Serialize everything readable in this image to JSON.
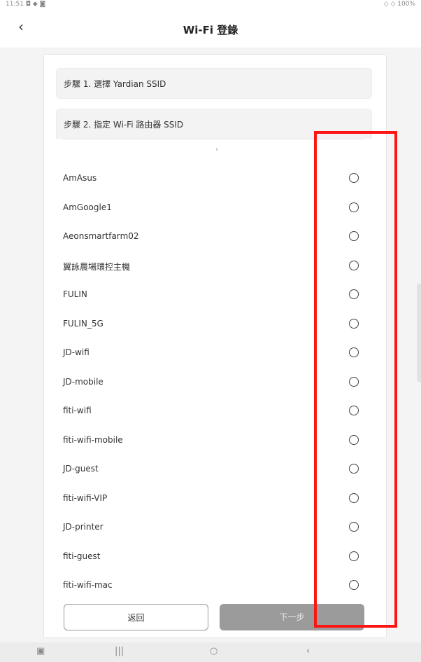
{
  "status_bar": {
    "left": "11:51 ◘ ◆ ◙",
    "right": "◇ ◇ 100%"
  },
  "header": {
    "back_icon": "chevron-left-icon",
    "title": "Wi-Fi 登錄"
  },
  "steps": {
    "step1_label": "步驟 1. 選擇 Yardian SSID",
    "step2_label": "步驟 2. 指定 Wi-Fi 路由器 SSID"
  },
  "networks": [
    {
      "ssid": "AmAsus"
    },
    {
      "ssid": "AmGoogle1"
    },
    {
      "ssid": "Aeonsmartfarm02"
    },
    {
      "ssid": "翼詠農場環控主機"
    },
    {
      "ssid": "FULIN"
    },
    {
      "ssid": "FULIN_5G"
    },
    {
      "ssid": "JD-wifi"
    },
    {
      "ssid": "JD-mobile"
    },
    {
      "ssid": "fiti-wifi"
    },
    {
      "ssid": "fiti-wifi-mobile"
    },
    {
      "ssid": "JD-guest"
    },
    {
      "ssid": "fiti-wifi-VIP"
    },
    {
      "ssid": "JD-printer"
    },
    {
      "ssid": "fiti-guest"
    },
    {
      "ssid": "fiti-wifi-mac"
    }
  ],
  "buttons": {
    "back_label": "返回",
    "next_label": "下一步"
  },
  "nav": {
    "recent": "▣",
    "apps": "|||",
    "home": "○",
    "back": "‹"
  },
  "colors": {
    "highlight": "#ff1414",
    "next_disabled": "#9b9b9b"
  }
}
